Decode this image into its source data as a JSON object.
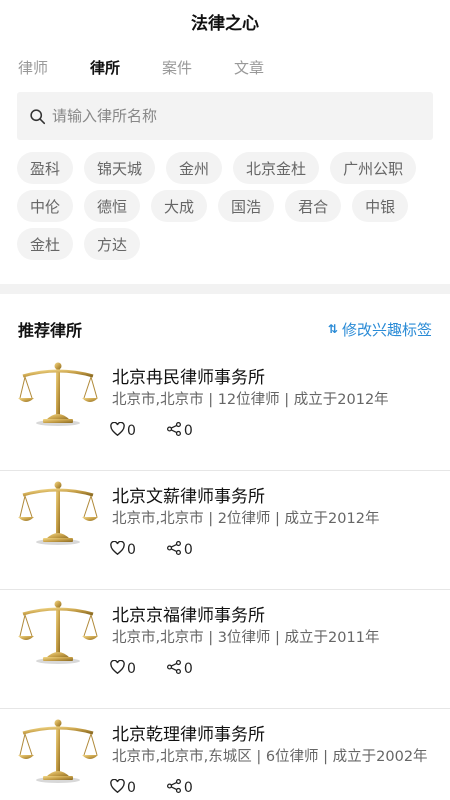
{
  "header": {
    "title": "法律之心"
  },
  "tabs": [
    {
      "label": "律师",
      "active": false
    },
    {
      "label": "律所",
      "active": true
    },
    {
      "label": "案件",
      "active": false
    },
    {
      "label": "文章",
      "active": false
    }
  ],
  "search": {
    "placeholder": "请输入律所名称",
    "value": ""
  },
  "tags": [
    "盈科",
    "锦天城",
    "金州",
    "北京金杜",
    "广州公职",
    "中伦",
    "德恒",
    "大成",
    "国浩",
    "君合",
    "中银",
    "金杜",
    "方达"
  ],
  "recommend": {
    "title": "推荐律所",
    "action_label": "修改兴趣标签",
    "action_icon": "sort-icon"
  },
  "firms": [
    {
      "name": "北京冉民律师事务所",
      "meta": "北京市,北京市 | 12位律师 | 成立于2012年",
      "likes": "0",
      "shares": "0"
    },
    {
      "name": "北京文薪律师事务所",
      "meta": "北京市,北京市 | 2位律师 | 成立于2012年",
      "likes": "0",
      "shares": "0"
    },
    {
      "name": "北京京福律师事务所",
      "meta": "北京市,北京市 | 3位律师 | 成立于2011年",
      "likes": "0",
      "shares": "0"
    },
    {
      "name": "北京乾理律师事务所",
      "meta": "北京市,北京市,东城区 | 6位律师 | 成立于2002年",
      "likes": "0",
      "shares": "0"
    }
  ],
  "colors": {
    "accent": "#2a8bd6",
    "tag_bg": "#f3f3f3",
    "gold": "#c9a24a"
  }
}
